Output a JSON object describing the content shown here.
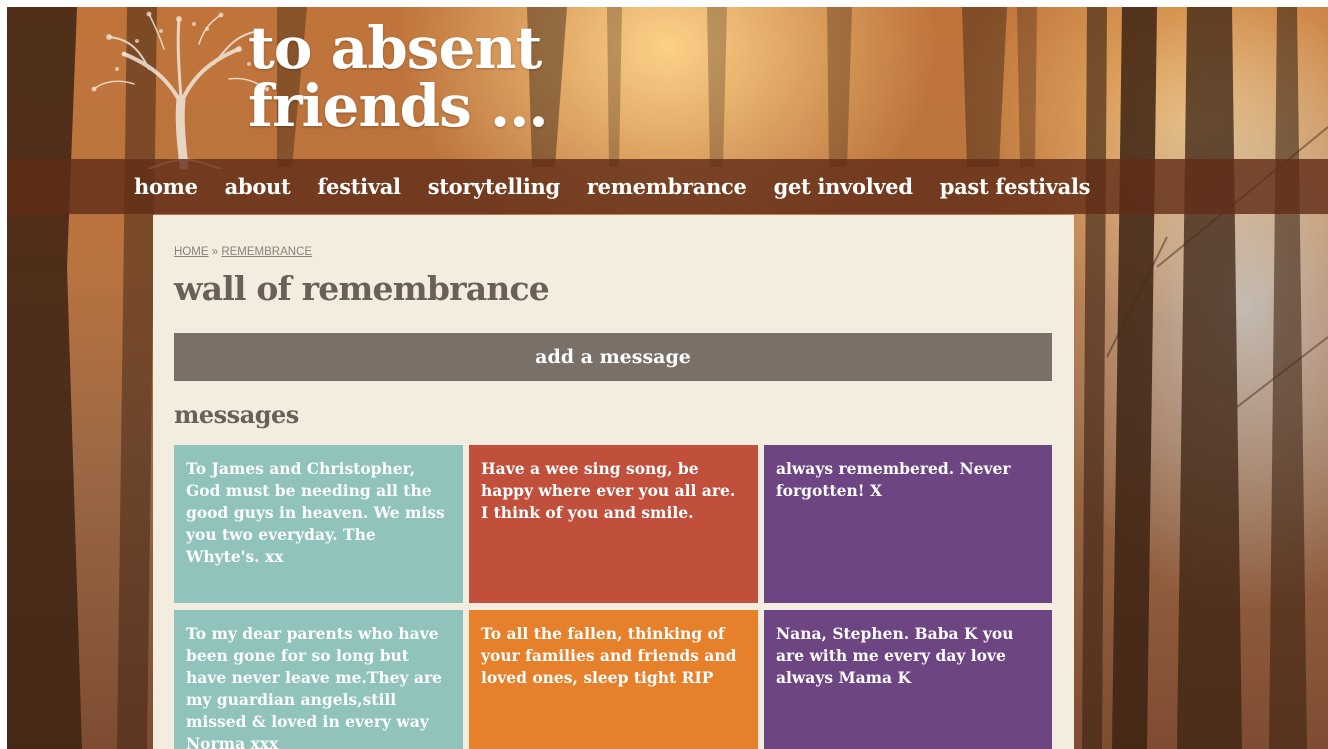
{
  "site": {
    "title_line1": "to absent",
    "title_line2": "friends ..."
  },
  "nav": {
    "items": [
      "home",
      "about",
      "festival",
      "storytelling",
      "remembrance",
      "get involved",
      "past festivals"
    ]
  },
  "breadcrumb": {
    "home": "HOME",
    "separator": "»",
    "current": "REMEMBRANCE"
  },
  "page": {
    "title": "wall of remembrance",
    "add_button_label": "add a message",
    "messages_heading": "messages"
  },
  "messages": [
    {
      "text": "To James and Christopher, God must be needing all the good guys in heaven. We miss you two everyday. The Whyte's. xx",
      "color": "#8fc3bb"
    },
    {
      "text": "Have a wee sing song, be happy where ever you all are. I think of you and smile.",
      "color": "#c04f3b"
    },
    {
      "text": "always remembered. Never forgotten! X",
      "color": "#6c4582"
    },
    {
      "text": "To my dear parents who have been gone for so long but have never leave me.They are my guardian angels,still missed & loved in every way Norma xxx",
      "color": "#8fc3bb"
    },
    {
      "text": "To all the fallen, thinking of your families and friends and loved ones, sleep tight RIP",
      "color": "#e6802a"
    },
    {
      "text": "Nana, Stephen. Baba K you are with me every day love always Mama K",
      "color": "#6c4582"
    }
  ]
}
